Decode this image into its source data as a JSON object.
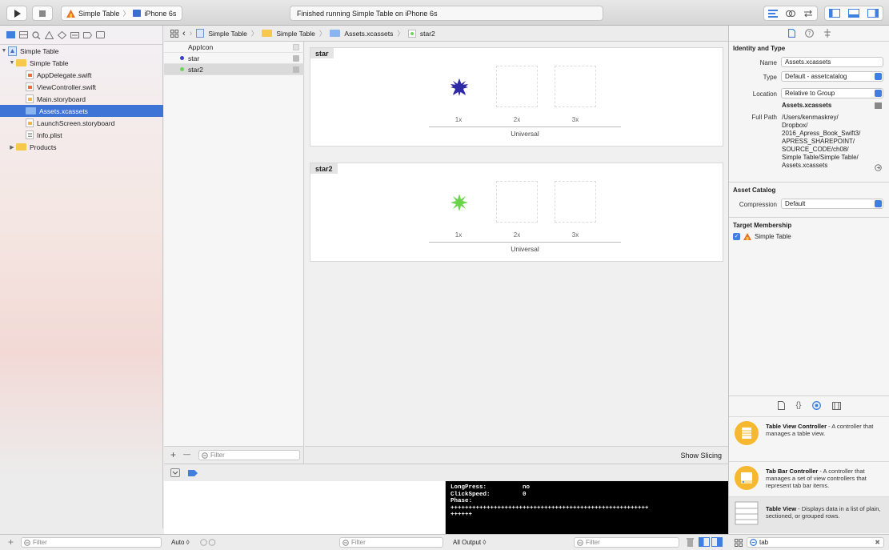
{
  "toolbar": {
    "scheme_project": "Simple Table",
    "scheme_device": "iPhone 6s",
    "activity_status": "Finished running Simple Table on iPhone 6s"
  },
  "navigator": {
    "filter_placeholder": "Filter",
    "items": [
      {
        "label": "Simple Table",
        "kind": "project"
      },
      {
        "label": "Simple Table",
        "kind": "folder"
      },
      {
        "label": "AppDelegate.swift",
        "kind": "swift"
      },
      {
        "label": "ViewController.swift",
        "kind": "swift"
      },
      {
        "label": "Main.storyboard",
        "kind": "storyboard"
      },
      {
        "label": "Assets.xcassets",
        "kind": "assets",
        "selected": true
      },
      {
        "label": "LaunchScreen.storyboard",
        "kind": "storyboard"
      },
      {
        "label": "Info.plist",
        "kind": "plist"
      },
      {
        "label": "Products",
        "kind": "folder"
      }
    ]
  },
  "jumpbar": {
    "crumbs": [
      "Simple Table",
      "Simple Table",
      "Assets.xcassets",
      "star2"
    ]
  },
  "assets": {
    "items": [
      {
        "label": "AppIcon"
      },
      {
        "label": "star",
        "color": "#3a3fc8"
      },
      {
        "label": "star2",
        "color": "#6fd35a",
        "selected": true
      }
    ],
    "filter_placeholder": "Filter",
    "add_label": "+",
    "remove_label": "—"
  },
  "canvas": {
    "sets": [
      {
        "name": "star",
        "scales": [
          "1x",
          "2x",
          "3x"
        ],
        "idiom": "Universal",
        "star_color": "#2e2aa6"
      },
      {
        "name": "star2",
        "scales": [
          "1x",
          "2x",
          "3x"
        ],
        "idiom": "Universal",
        "star_color": "#6ad34a"
      }
    ],
    "show_slicing": "Show Slicing"
  },
  "debug": {
    "auto_label": "Auto ◊",
    "vars_filter_placeholder": "Filter",
    "output_label": "All Output ◊",
    "console_filter_placeholder": "Filter",
    "console_lines": [
      "LongPress:          no",
      "ClickSpeed:         0",
      "Phase:",
      "+++++++++++++++++++++++++++++++++++++++++++++++++++++++",
      "++++++"
    ]
  },
  "inspector": {
    "identity_title": "Identity and Type",
    "name_label": "Name",
    "name_value": "Assets.xcassets",
    "type_label": "Type",
    "type_value": "Default - assetcatalog",
    "location_label": "Location",
    "location_value": "Relative to Group",
    "location_file": "Assets.xcassets",
    "fullpath_label": "Full Path",
    "fullpath_lines": [
      "/Users/kenmaskrey/",
      "Dropbox/",
      "2016_Apress_Book_Swift3/",
      "APRESS_SHAREPOINT/",
      "SOURCE_CODE/ch08/",
      "Simple Table/Simple Table/",
      "Assets.xcassets"
    ],
    "catalog_title": "Asset Catalog",
    "compression_label": "Compression",
    "compression_value": "Default",
    "membership_title": "Target Membership",
    "membership_target": "Simple Table",
    "library": [
      {
        "title": "Table View Controller",
        "desc": " - A controller that manages a table view."
      },
      {
        "title": "Tab Bar Controller",
        "desc": " - A controller that manages a set of view controllers that represent tab bar items."
      },
      {
        "title": "Table View",
        "desc": " - Displays data in a list of plain, sectioned, or grouped rows."
      }
    ],
    "library_search_value": "tab"
  },
  "colors": {
    "selection": "#3e74d6",
    "accent": "#3f7fe0",
    "folder": "#f6c94c"
  }
}
